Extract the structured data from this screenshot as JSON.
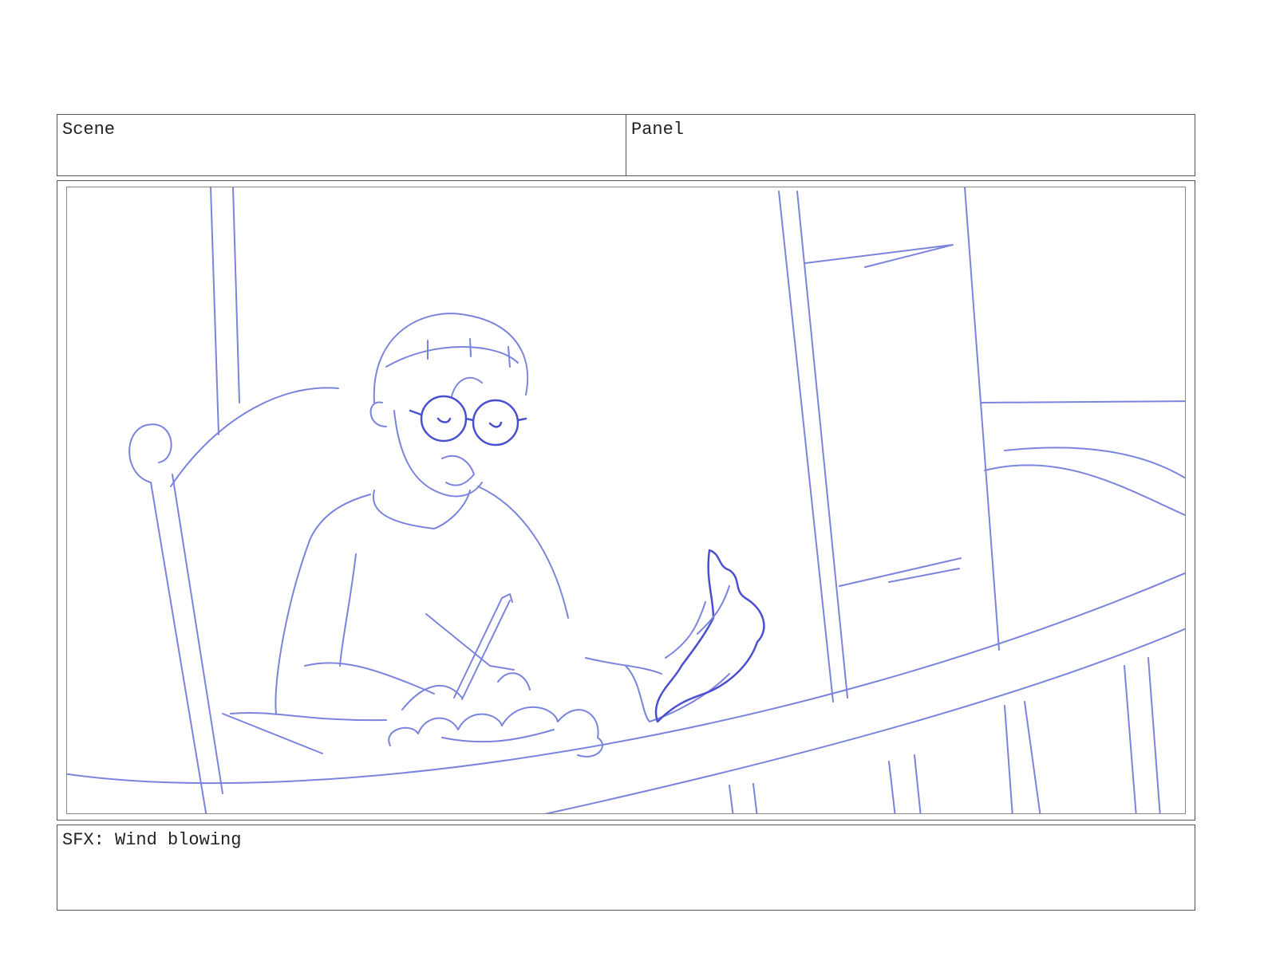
{
  "header": {
    "scene_label": "Scene",
    "panel_label": "Panel"
  },
  "notes": {
    "text": "SFX: Wind blowing"
  },
  "colors": {
    "sketch_line": "#7b84dd",
    "sketch_dark": "#4a4fd0",
    "border": "#555555"
  }
}
